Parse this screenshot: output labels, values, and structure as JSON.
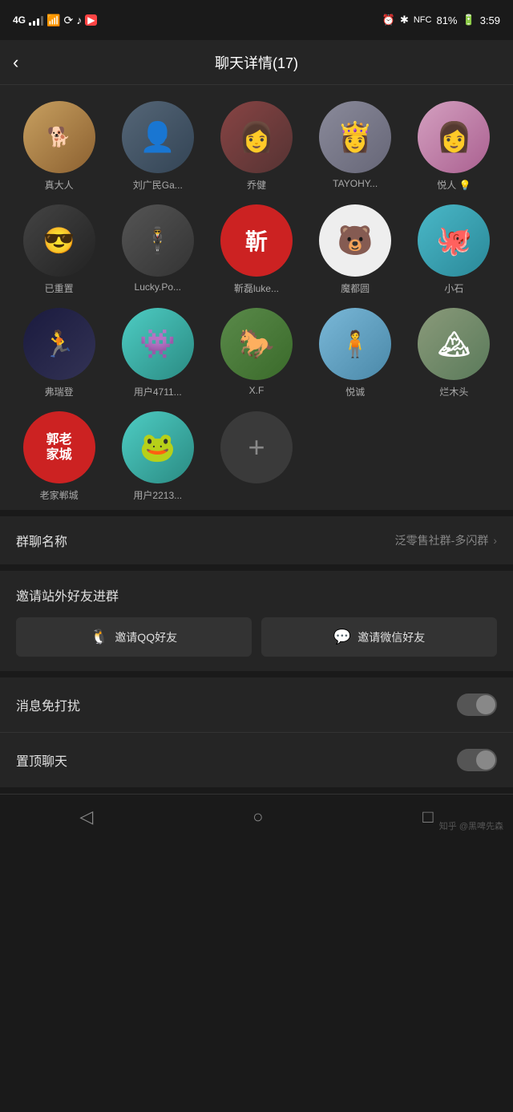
{
  "status": {
    "network": "4G",
    "time": "3:59",
    "battery": "81%"
  },
  "header": {
    "title": "聊天详情(17)",
    "back_label": "‹"
  },
  "members": [
    {
      "name": "真大人",
      "color": "#c8893a",
      "emoji": "🐕",
      "id": "m1"
    },
    {
      "name": "刘广民Ga...",
      "color": "#445566",
      "emoji": "👤",
      "id": "m2"
    },
    {
      "name": "乔健",
      "color": "#883333",
      "emoji": "👩",
      "id": "m3"
    },
    {
      "name": "TAYOHY...",
      "color": "#7a7a8a",
      "emoji": "👸",
      "id": "m4"
    },
    {
      "name": "悦人 💡",
      "color": "#c9a0c9",
      "emoji": "👩",
      "id": "m5"
    },
    {
      "name": "已重置",
      "color": "#333344",
      "emoji": "😎",
      "id": "m6"
    },
    {
      "name": "Lucky.Po...",
      "color": "#444444",
      "emoji": "🕴",
      "id": "m7"
    },
    {
      "name": "靳磊luke...",
      "color": "#cc2222",
      "text": "靳",
      "id": "m8"
    },
    {
      "name": "魔都圆",
      "color": "#ffffff",
      "emoji": "🐻",
      "id": "m9"
    },
    {
      "name": "小石",
      "color": "#4ab8c8",
      "emoji": "🐙",
      "id": "m10"
    },
    {
      "name": "弗瑞登",
      "color": "#1a1a2e",
      "emoji": "🏃",
      "id": "m11"
    },
    {
      "name": "用户4711...",
      "color": "#4ecdc4",
      "emoji": "👾",
      "id": "m12"
    },
    {
      "name": "X.F",
      "color": "#4a7a3a",
      "emoji": "🐎",
      "id": "m13"
    },
    {
      "name": "悦诚",
      "color": "#7ab8d8",
      "emoji": "👤",
      "id": "m14"
    },
    {
      "name": "烂木头",
      "color": "#8a9a7a",
      "emoji": "🏔",
      "id": "m15"
    },
    {
      "name": "老家郸城",
      "color": "#cc2222",
      "text": "郭老家城",
      "id": "m16"
    },
    {
      "name": "用户2213...",
      "color": "#4ecdc4",
      "emoji": "🐸",
      "id": "m17"
    }
  ],
  "group_name": {
    "label": "群聊名称",
    "value": "泛零售社群-多闪群"
  },
  "invite": {
    "label": "邀请站外好友进群",
    "qq_btn": "邀请QQ好友",
    "wechat_btn": "邀请微信好友"
  },
  "settings": [
    {
      "label": "消息免打扰",
      "id": "do-not-disturb"
    },
    {
      "label": "置顶聊天",
      "id": "pin-chat"
    }
  ],
  "bottom_nav": {
    "back": "◁",
    "home": "○",
    "recent": "□",
    "watermark": "知乎 @黑啤先森"
  }
}
